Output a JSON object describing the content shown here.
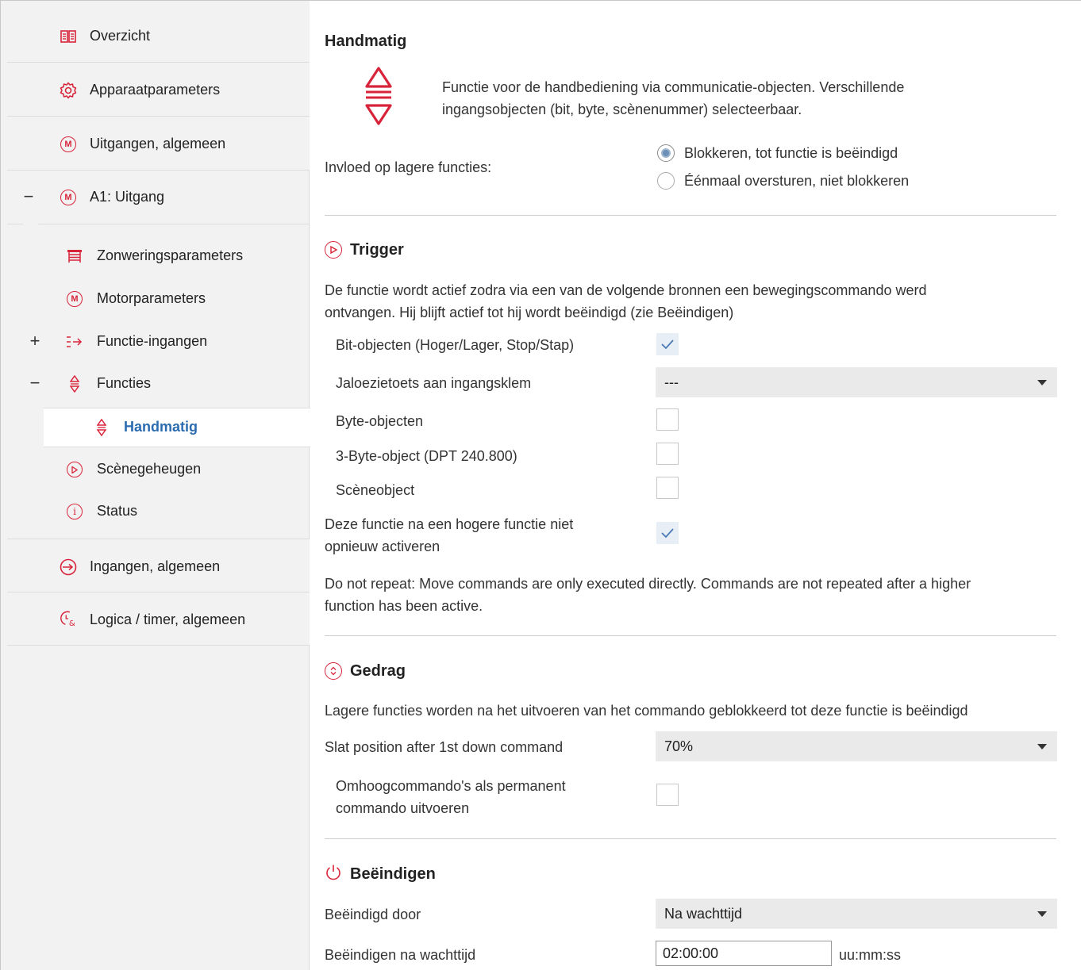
{
  "sidebar": {
    "items": [
      {
        "label": "Overzicht",
        "icon": "book-icon"
      },
      {
        "label": "Apparaatparameters",
        "icon": "gear-icon"
      },
      {
        "label": "Uitgangen, algemeen",
        "icon": "motor-icon"
      },
      {
        "label": "A1: Uitgang",
        "icon": "motor-icon",
        "expander": "−"
      },
      {
        "label": "Zonweringsparameters",
        "icon": "blind-icon"
      },
      {
        "label": "Motorparameters",
        "icon": "motor-icon"
      },
      {
        "label": "Functie-ingangen",
        "icon": "input-arrow-icon",
        "expander": "+"
      },
      {
        "label": "Functies",
        "icon": "up-down-icon",
        "expander": "−"
      },
      {
        "label": "Handmatig",
        "icon": "up-down-icon",
        "selected": true
      },
      {
        "label": "Scènegeheugen",
        "icon": "play-circle-icon"
      },
      {
        "label": "Status",
        "icon": "info-icon"
      },
      {
        "label": "Ingangen, algemeen",
        "icon": "input-circle-icon"
      },
      {
        "label": "Logica / timer, algemeen",
        "icon": "logic-timer-icon"
      }
    ],
    "motor_letter": "M"
  },
  "main": {
    "title": "Handmatig",
    "description": "Functie voor de handbediening via communicatie-objecten. Verschillende ingangsobjecten (bit, byte, scènenummer) selecteerbaar.",
    "description_lines": [
      "Functie voor de handbediening via communicatie-objecten. Verschillende",
      "ingangsobjecten (bit, byte, scènenummer) selecteerbaar."
    ],
    "influence": {
      "label": "Invloed op lagere functies:",
      "options": [
        "Blokkeren, tot functie is beëindigd",
        "Éénmaal oversturen, niet blokkeren"
      ],
      "selected": 0
    },
    "trigger": {
      "title": "Trigger",
      "desc_lines": [
        "De functie wordt actief zodra via een van de volgende bronnen een bewegingscommando werd",
        "ontvangen. Hij blijft actief tot hij wordt beëindigd (zie Beëindigen)"
      ],
      "bit_objects": {
        "label": "Bit-objecten (Hoger/Lager, Stop/Stap)",
        "checked": true
      },
      "jalousie": {
        "label": "Jaloezietoets aan ingangsklem",
        "value": "---"
      },
      "byte_objects": {
        "label": "Byte-objecten",
        "checked": false
      },
      "three_byte": {
        "label": "3-Byte-object (DPT 240.800)",
        "checked": false
      },
      "scene_object": {
        "label": "Scèneobject",
        "checked": false
      },
      "no_reactivate": {
        "label_lines": [
          "Deze functie na een hogere functie niet",
          "opnieuw activeren"
        ],
        "checked": true
      },
      "note_lines": [
        "Do not repeat: Move commands are only executed directly. Commands are not repeated after a higher",
        "function has been active."
      ]
    },
    "gedrag": {
      "title": "Gedrag",
      "desc": "Lagere functies worden na het uitvoeren van het commando geblokkeerd tot deze functie is beëindigd",
      "slat": {
        "label": "Slat position after 1st down command",
        "value": "70%"
      },
      "permanent_up": {
        "label_lines": [
          "Omhoogcommando's als permanent",
          "commando uitvoeren"
        ],
        "checked": false
      }
    },
    "beeindigen": {
      "title": "Beëindigen",
      "ended_by": {
        "label": "Beëindigd door",
        "value": "Na wachttijd"
      },
      "wait": {
        "label": "Beëindigen na wachttijd",
        "value": "02:00:00",
        "unit": "uu:mm:ss"
      }
    },
    "check_mark": "✓"
  },
  "colors": {
    "accent": "#d8243a",
    "selected_text": "#2b6cb0",
    "check": "#4a7ab5"
  }
}
